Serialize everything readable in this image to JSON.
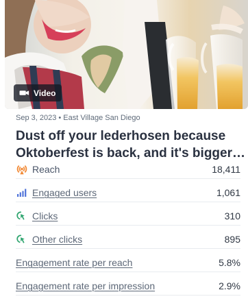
{
  "media": {
    "video_label": "Video",
    "video_icon": "video-camera-icon"
  },
  "post": {
    "meta": "Sep 3, 2023 • East Village San Diego",
    "title_line_1": "Dust off your lederhosen because",
    "title_line_2": "Oktoberfest is back, and it's bigger…"
  },
  "metrics": [
    {
      "label": "Reach",
      "value": "18,411",
      "icon": "broadcast-icon",
      "icon_color": "#f28b38",
      "link": false
    },
    {
      "label": "Engaged users",
      "value": "1,061",
      "icon": "bar-chart-icon",
      "icon_color": "#4f73d9",
      "link": true
    },
    {
      "label": "Clicks",
      "value": "310",
      "icon": "cursor-click-icon",
      "icon_color": "#2fa56f",
      "link": true
    },
    {
      "label": "Other clicks",
      "value": "895",
      "icon": "cursor-click-icon",
      "icon_color": "#2fa56f",
      "link": true
    },
    {
      "label": "Engagement rate per reach",
      "value": "5.8%",
      "icon": "",
      "icon_color": "",
      "link": true
    },
    {
      "label": "Engagement rate per impression",
      "value": "2.9%",
      "icon": "",
      "icon_color": "",
      "link": true
    }
  ]
}
